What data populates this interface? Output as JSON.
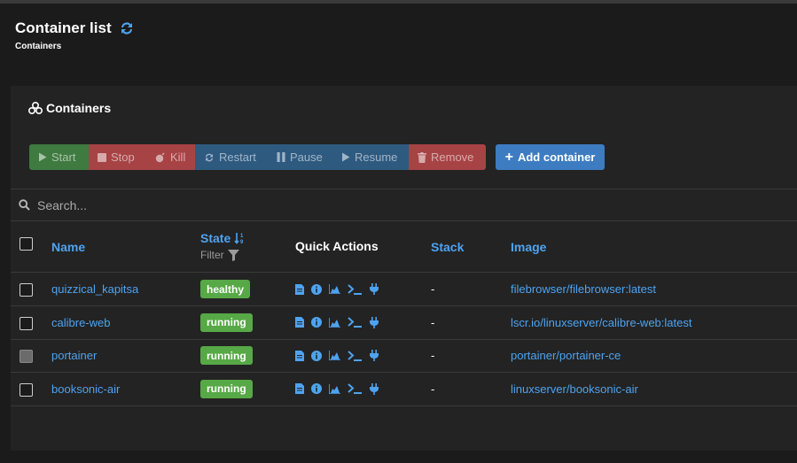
{
  "header": {
    "title": "Container list",
    "subtitle": "Containers"
  },
  "panel": {
    "title": "Containers"
  },
  "toolbar": {
    "start_label": "Start",
    "stop_label": "Stop",
    "kill_label": "Kill",
    "restart_label": "Restart",
    "pause_label": "Pause",
    "resume_label": "Resume",
    "remove_label": "Remove",
    "add_label": "Add container"
  },
  "search": {
    "placeholder": "Search..."
  },
  "table": {
    "headers": {
      "name": "Name",
      "state": "State",
      "filter": "Filter",
      "quick_actions": "Quick Actions",
      "stack": "Stack",
      "image": "Image"
    },
    "rows": [
      {
        "name": "quizzical_kapitsa",
        "state": "healthy",
        "stack": "-",
        "image": "filebrowser/filebrowser:latest"
      },
      {
        "name": "calibre-web",
        "state": "running",
        "stack": "-",
        "image": "lscr.io/linuxserver/calibre-web:latest"
      },
      {
        "name": "portainer",
        "state": "running",
        "stack": "-",
        "image": "portainer/portainer-ce"
      },
      {
        "name": "booksonic-air",
        "state": "running",
        "stack": "-",
        "image": "linuxserver/booksonic-air"
      }
    ]
  },
  "quick_action_icons": [
    "logs-icon",
    "inspect-icon",
    "stats-icon",
    "console-icon",
    "attach-icon"
  ],
  "colors": {
    "accent_link": "#4ea3f1",
    "start": "#3f7a40",
    "danger": "#a74345",
    "primary": "#2e5a80",
    "add": "#3d7cc1",
    "status_ok": "#57a846"
  }
}
